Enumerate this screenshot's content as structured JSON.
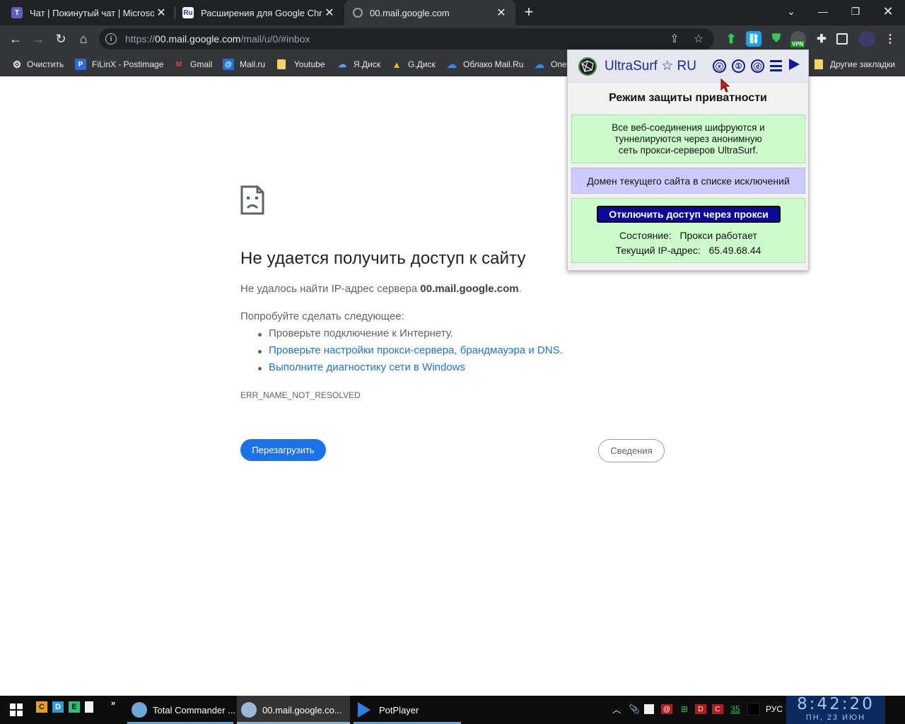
{
  "tabs": [
    {
      "title": "Чат | Покинутый чат | Microsoft",
      "favicon": "teams-icon"
    },
    {
      "title": "Расширения для Google Chrom",
      "favicon": "ru-icon",
      "favicon_text": "Ru"
    },
    {
      "title": "00.mail.google.com",
      "favicon": "globe-icon",
      "active": true
    }
  ],
  "address_bar": {
    "url_prefix": "https://",
    "url_host": "00.mail.google.com",
    "url_path": "/mail/u/0/#inbox"
  },
  "bookmarks": [
    {
      "label": "Очистить",
      "icon": "gear-icon"
    },
    {
      "label": "FiLinX - Postimage",
      "icon": "postimage-icon",
      "icon_text": "P"
    },
    {
      "label": "Gmail",
      "icon": "gmail-icon",
      "icon_text": "M"
    },
    {
      "label": "Mail.ru",
      "icon": "mailru-icon",
      "icon_text": "@"
    },
    {
      "label": "Youtube",
      "icon": "folder-icon"
    },
    {
      "label": "Я.Диск",
      "icon": "yadisk-icon"
    },
    {
      "label": "G.Диск",
      "icon": "gdrive-icon"
    },
    {
      "label": "Облако Mail.Ru",
      "icon": "cloud-icon"
    },
    {
      "label": "One",
      "icon": "onedrive-icon"
    }
  ],
  "bookmarks_other": "Другие закладки",
  "error_page": {
    "title": "Не удается получить доступ к сайту",
    "message_prefix": "Не удалось найти IP-адрес сервера ",
    "message_host": "00.mail.google.com",
    "message_suffix": ".",
    "try_heading": "Попробуйте сделать следующее:",
    "suggestion_plain": "Проверьте подключение к Интернету.",
    "suggestion_link1": "Проверьте настройки прокси-сервера, брандмауэра и DNS.",
    "suggestion_link2": "Выполните диагностику сети в Windows",
    "error_code": "ERR_NAME_NOT_RESOLVED",
    "reload_button": "Перезагрузить",
    "details_button": "Сведения"
  },
  "ultrasurf": {
    "title": "UltraSurf ☆ RU",
    "header_icons": [
      "ⓧ",
      "①",
      "ⓓ"
    ],
    "heading": "Режим защиты приватности",
    "info_line1": "Все веб-соединения шифруются и",
    "info_line2": "туннелируются через анонимную",
    "info_line3": "сеть прокси-серверов UltraSurf.",
    "exception_note": "Домен текущего сайта в списке исключений",
    "disable_button": "Отключить доступ через прокси",
    "state_label": "Состояние:",
    "state_value": "Прокси работает",
    "ip_label": "Текущий IP-адрес:",
    "ip_value": "65.49.68.44"
  },
  "extension_badge": "VPN",
  "taskbar": {
    "quicklaunch": [
      "C",
      "D",
      "E"
    ],
    "tasks": [
      {
        "label": "Total Commander ...",
        "icon": "total-commander-icon"
      },
      {
        "label": "00.mail.google.co...",
        "icon": "browser-icon",
        "active": true
      },
      {
        "label": "PotPlayer",
        "icon": "potplayer-icon"
      }
    ],
    "tray_counter": "35",
    "language": "РУС",
    "clock_time": "8:42:20",
    "clock_date": "ПН, 23 ИЮН"
  },
  "colors": {
    "chrome_dark": "#202124",
    "toolbar": "#35363a",
    "link": "#1a73e8",
    "popup_green": "#ccfccc",
    "popup_lilac": "#ccccff",
    "popup_button": "#0a0a9a"
  }
}
